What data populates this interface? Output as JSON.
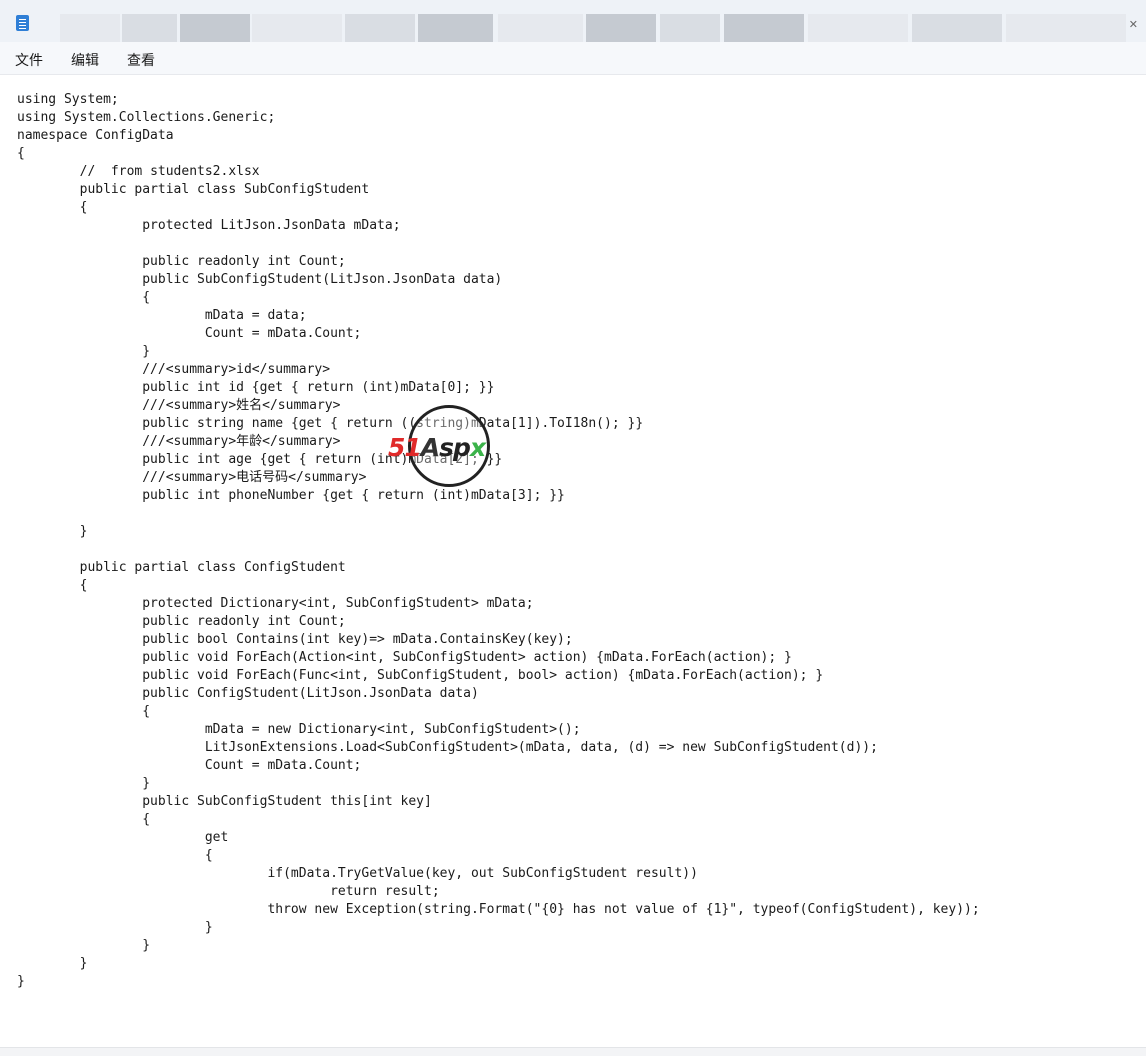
{
  "menu": {
    "items": [
      {
        "label": "文件"
      },
      {
        "label": "编辑"
      },
      {
        "label": "查看"
      }
    ]
  },
  "watermark": {
    "part1": "51",
    "part2": "A",
    "part3": "sp",
    "part4": "x"
  },
  "editor": {
    "lines": [
      "using System;",
      "using System.Collections.Generic;",
      "namespace ConfigData",
      "{",
      "\t//  from students2.xlsx",
      "\tpublic partial class SubConfigStudent",
      "\t{",
      "\t\tprotected LitJson.JsonData mData;",
      "",
      "\t\tpublic readonly int Count;",
      "\t\tpublic SubConfigStudent(LitJson.JsonData data)",
      "\t\t{",
      "\t\t\tmData = data;",
      "\t\t\tCount = mData.Count;",
      "\t\t}",
      "\t\t///<summary>id</summary>",
      "\t\tpublic int id {get { return (int)mData[0]; }}",
      "\t\t///<summary>姓名</summary>",
      "\t\tpublic string name {get { return ((string)mData[1]).ToI18n(); }}",
      "\t\t///<summary>年龄</summary>",
      "\t\tpublic int age {get { return (int)mData[2]; }}",
      "\t\t///<summary>电话号码</summary>",
      "\t\tpublic int phoneNumber {get { return (int)mData[3]; }}",
      "",
      "\t}",
      "",
      "\tpublic partial class ConfigStudent",
      "\t{",
      "\t\tprotected Dictionary<int, SubConfigStudent> mData;",
      "\t\tpublic readonly int Count;",
      "\t\tpublic bool Contains(int key)=> mData.ContainsKey(key);",
      "\t\tpublic void ForEach(Action<int, SubConfigStudent> action) {mData.ForEach(action); }",
      "\t\tpublic void ForEach(Func<int, SubConfigStudent, bool> action) {mData.ForEach(action); }",
      "\t\tpublic ConfigStudent(LitJson.JsonData data)",
      "\t\t{",
      "\t\t\tmData = new Dictionary<int, SubConfigStudent>();",
      "\t\t\tLitJsonExtensions.Load<SubConfigStudent>(mData, data, (d) => new SubConfigStudent(d));",
      "\t\t\tCount = mData.Count;",
      "\t\t}",
      "\t\tpublic SubConfigStudent this[int key]",
      "\t\t{",
      "\t\t\tget",
      "\t\t\t{",
      "\t\t\t\tif(mData.TryGetValue(key, out SubConfigStudent result))",
      "\t\t\t\t\treturn result;",
      "\t\t\t\tthrow new Exception(string.Format(\"{0} has not value of {1}\", typeof(ConfigStudent), key));",
      "\t\t\t}",
      "\t\t}",
      "\t}",
      "}"
    ]
  }
}
